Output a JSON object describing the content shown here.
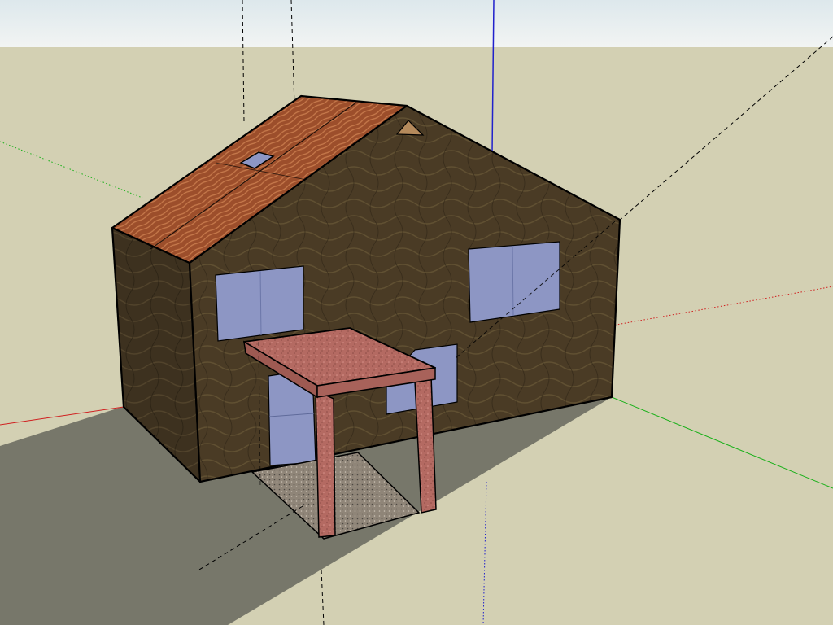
{
  "viewport": {
    "model": "house",
    "colors": {
      "sky": "#dde8ec",
      "sky_horizon": "#f2f4f3",
      "ground": "#d3d0b3",
      "shadow": "#77776a",
      "wall": "#4a3b25",
      "roof": "#9c4e2b",
      "glass": "#8d96c4",
      "porch": "#b46a62",
      "porch_floor": "#8f8578",
      "edge": "#000000",
      "axis_red": "#d02020",
      "axis_green": "#18b018",
      "axis_blue": "#2020cc"
    }
  }
}
